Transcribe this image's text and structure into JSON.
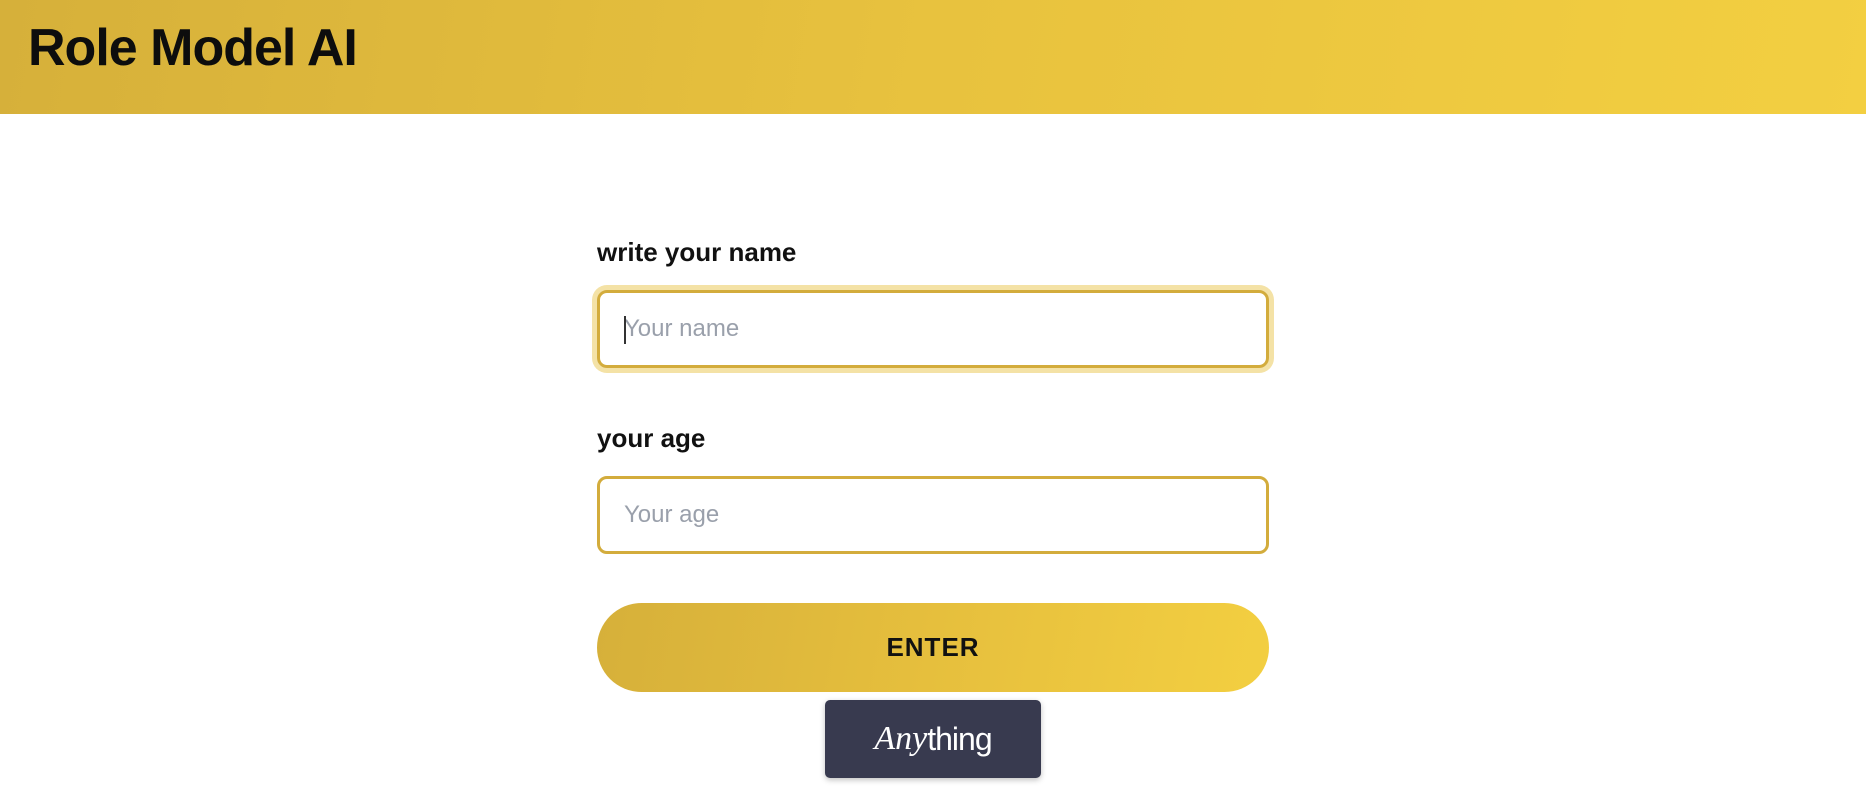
{
  "header": {
    "title": "Role Model AI",
    "background_colors": [
      "#d6b03a",
      "#f3cf41"
    ]
  },
  "form": {
    "name_label": "write your name",
    "name_placeholder": "Your name",
    "name_value": "",
    "age_label": "your age",
    "age_placeholder": "Your age",
    "age_value": "",
    "submit_label": "ENTER",
    "input_border_color": "#d3ac3c"
  },
  "badge": {
    "italic_part": "Any",
    "rest_part": "thing",
    "background_color": "#383a4f"
  }
}
